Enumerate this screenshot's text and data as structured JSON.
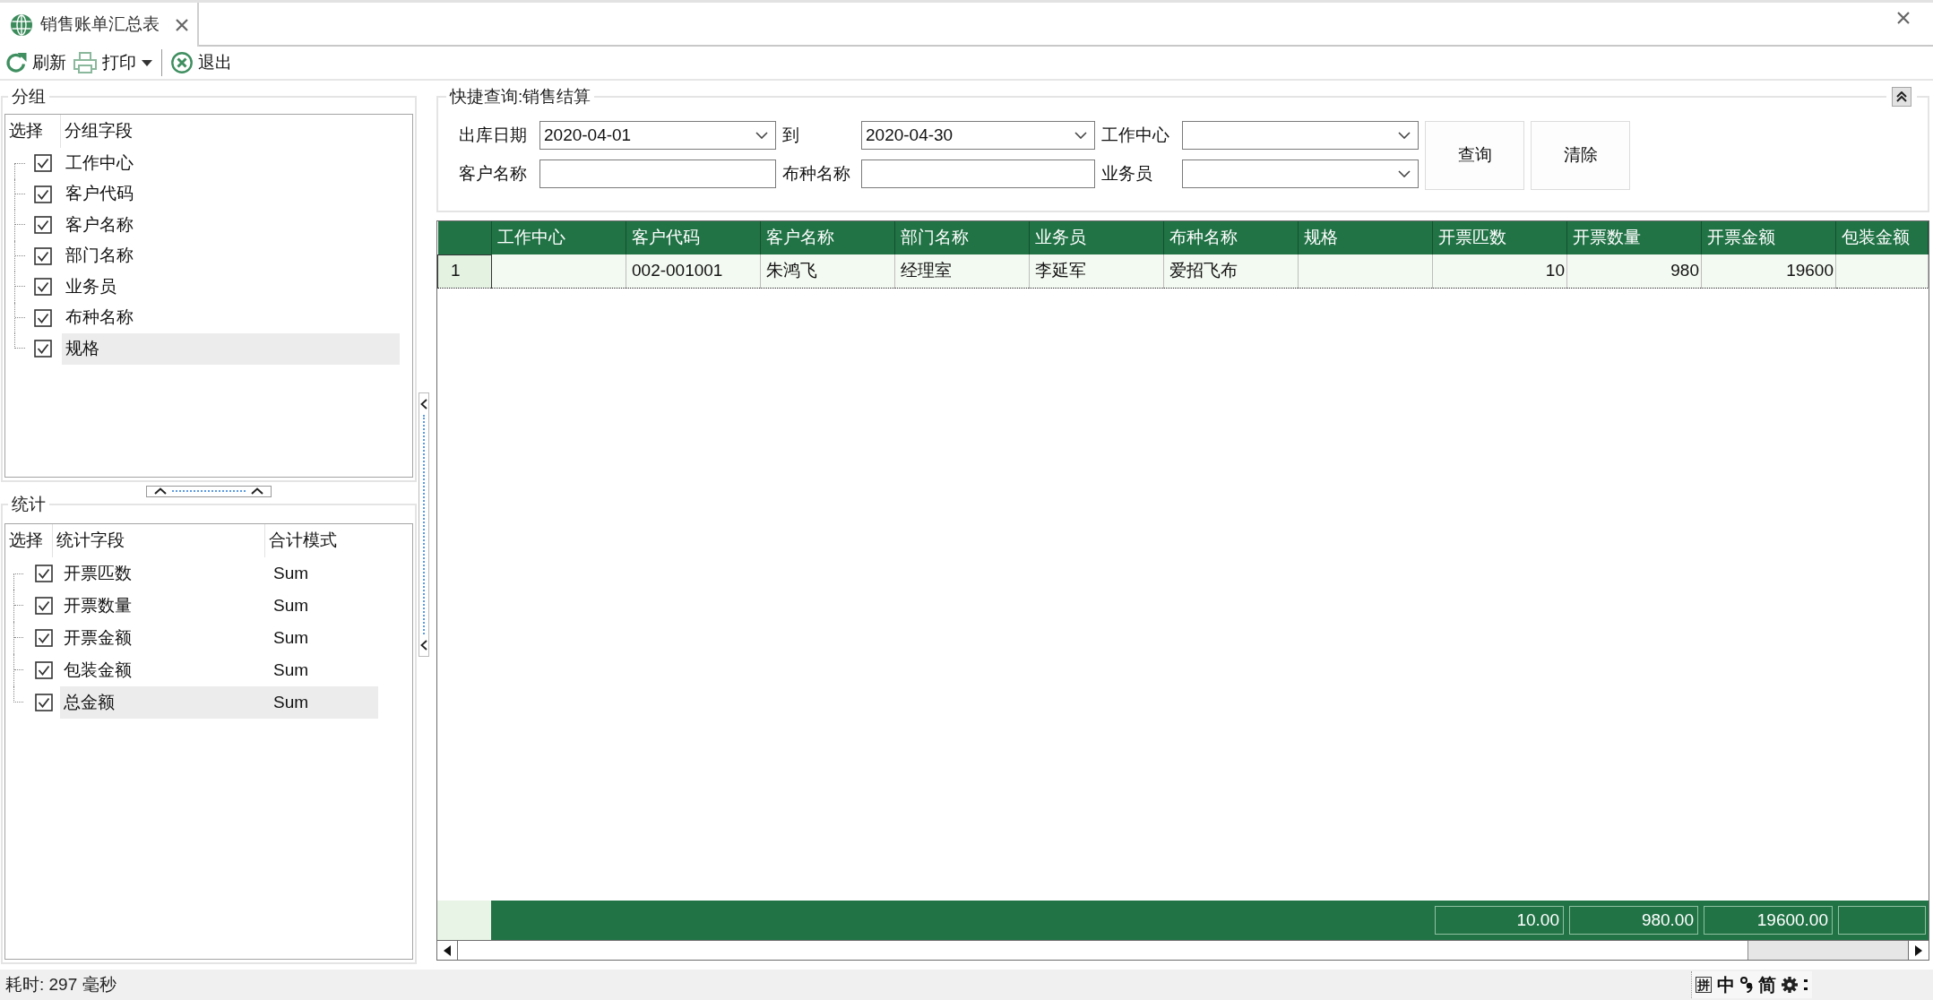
{
  "tabs": [
    {
      "title": "销售账单汇总表",
      "selected": true
    }
  ],
  "toolbar": [
    {
      "kind": "refresh",
      "label": "刷新"
    },
    {
      "kind": "print",
      "label": "打印"
    },
    {
      "kind": "separator"
    },
    {
      "kind": "exit",
      "label": "退出"
    }
  ],
  "group_panel": {
    "title": "分组",
    "columns": [
      "选择",
      "分组字段"
    ],
    "rows": [
      {
        "field": "工作中心",
        "checked": true,
        "selected": false
      },
      {
        "field": "客户代码",
        "checked": true,
        "selected": false
      },
      {
        "field": "客户名称",
        "checked": true,
        "selected": false
      },
      {
        "field": "部门名称",
        "checked": true,
        "selected": false
      },
      {
        "field": "业务员",
        "checked": true,
        "selected": false
      },
      {
        "field": "布种名称",
        "checked": true,
        "selected": false
      },
      {
        "field": "规格",
        "checked": true,
        "selected": true
      }
    ]
  },
  "stats_panel": {
    "title": "统计",
    "columns": [
      "选择",
      "统计字段",
      "合计模式"
    ],
    "rows": [
      {
        "field": "开票匹数",
        "mode": "Sum",
        "checked": true,
        "selected": false
      },
      {
        "field": "开票数量",
        "mode": "Sum",
        "checked": true,
        "selected": false
      },
      {
        "field": "开票金额",
        "mode": "Sum",
        "checked": true,
        "selected": false
      },
      {
        "field": "包装金额",
        "mode": "Sum",
        "checked": true,
        "selected": false
      },
      {
        "field": "总金额",
        "mode": "Sum",
        "checked": true,
        "selected": true
      }
    ]
  },
  "query_panel": {
    "title": "快捷查询:销售结算",
    "fields": [
      {
        "label": "出库日期",
        "kind": "dropdown",
        "value": "2020-04-01"
      },
      {
        "label": "到",
        "kind": "dropdown",
        "value": "2020-04-30"
      },
      {
        "label": "工作中心",
        "kind": "dropdown"
      },
      {
        "label": "客户名称",
        "kind": "text"
      },
      {
        "label": "布种名称",
        "kind": "text"
      },
      {
        "label": "业务员",
        "kind": "dropdown"
      }
    ],
    "buttons": [
      "查询",
      "清除"
    ]
  },
  "grid": {
    "columns": [
      {
        "title": "工作中心",
        "kind": "text"
      },
      {
        "title": "客户代码",
        "kind": "text"
      },
      {
        "title": "客户名称",
        "kind": "text"
      },
      {
        "title": "部门名称",
        "kind": "text"
      },
      {
        "title": "业务员",
        "kind": "text"
      },
      {
        "title": "布种名称",
        "kind": "text"
      },
      {
        "title": "规格",
        "kind": "text"
      },
      {
        "title": "开票匹数",
        "kind": "number",
        "total": "10.00"
      },
      {
        "title": "开票数量",
        "kind": "number",
        "total": "980.00"
      },
      {
        "title": "开票金额",
        "kind": "number",
        "total": "19600.00"
      },
      {
        "title": "包装金额",
        "kind": "number"
      }
    ],
    "rows": [
      {
        "number": "1",
        "selected": true,
        "cells": [
          null,
          "002-001001",
          "朱鸿飞",
          "经理室",
          "李延军",
          "爱招飞布",
          null,
          "10",
          "980",
          "19600",
          null
        ]
      }
    ]
  },
  "status_bar": {
    "text": "耗时: 297 毫秒",
    "ime": [
      {
        "kind": "boxed",
        "label": "拼"
      },
      {
        "kind": "text",
        "label": "中"
      },
      {
        "kind": "punctuation"
      },
      {
        "kind": "text",
        "label": "简"
      },
      {
        "kind": "settings"
      },
      {
        "kind": "more"
      }
    ]
  }
}
